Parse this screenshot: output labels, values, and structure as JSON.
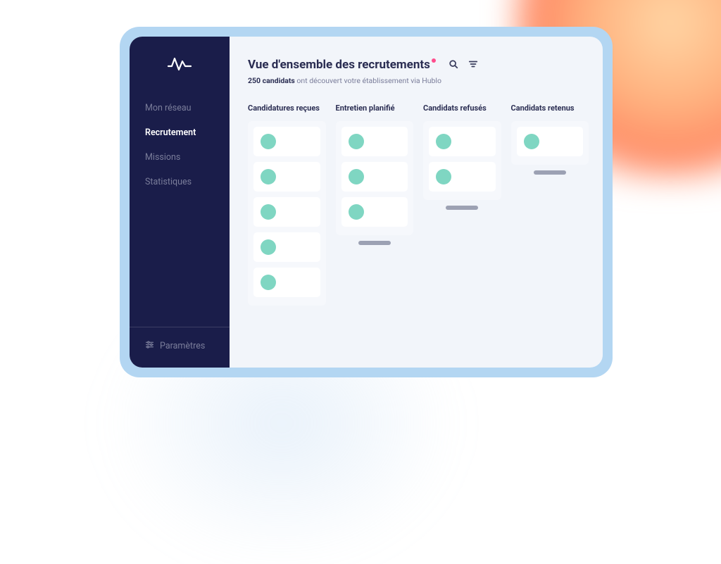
{
  "sidebar": {
    "nav": [
      {
        "label": "Mon réseau",
        "active": false
      },
      {
        "label": "Recrutement",
        "active": true
      },
      {
        "label": "Missions",
        "active": false
      },
      {
        "label": "Statistiques",
        "active": false
      }
    ],
    "settings_label": "Paramètres"
  },
  "header": {
    "title": "Vue d'ensemble des recrutements",
    "subtitle_count": "250 candidats",
    "subtitle_rest": " ont découvert votre établissement via Hublo"
  },
  "board": {
    "columns": [
      {
        "title": "Candidatures reçues",
        "card_count": 5,
        "has_add": false
      },
      {
        "title": "Entretien planifié",
        "card_count": 3,
        "has_add": true
      },
      {
        "title": "Candidats refusés",
        "card_count": 2,
        "has_add": true
      },
      {
        "title": "Candidats retenus",
        "card_count": 1,
        "has_add": true
      }
    ]
  },
  "colors": {
    "sidebar_bg": "#1a1d4a",
    "accent_dot": "#ff4d8d",
    "avatar": "#7fd6c2",
    "screen_bg": "#f2f5fa",
    "tablet_bg": "#b3d6f2"
  },
  "icons": {
    "search": "search-icon",
    "filter": "filter-icon",
    "settings": "sliders-icon",
    "logo": "pulse-icon"
  }
}
